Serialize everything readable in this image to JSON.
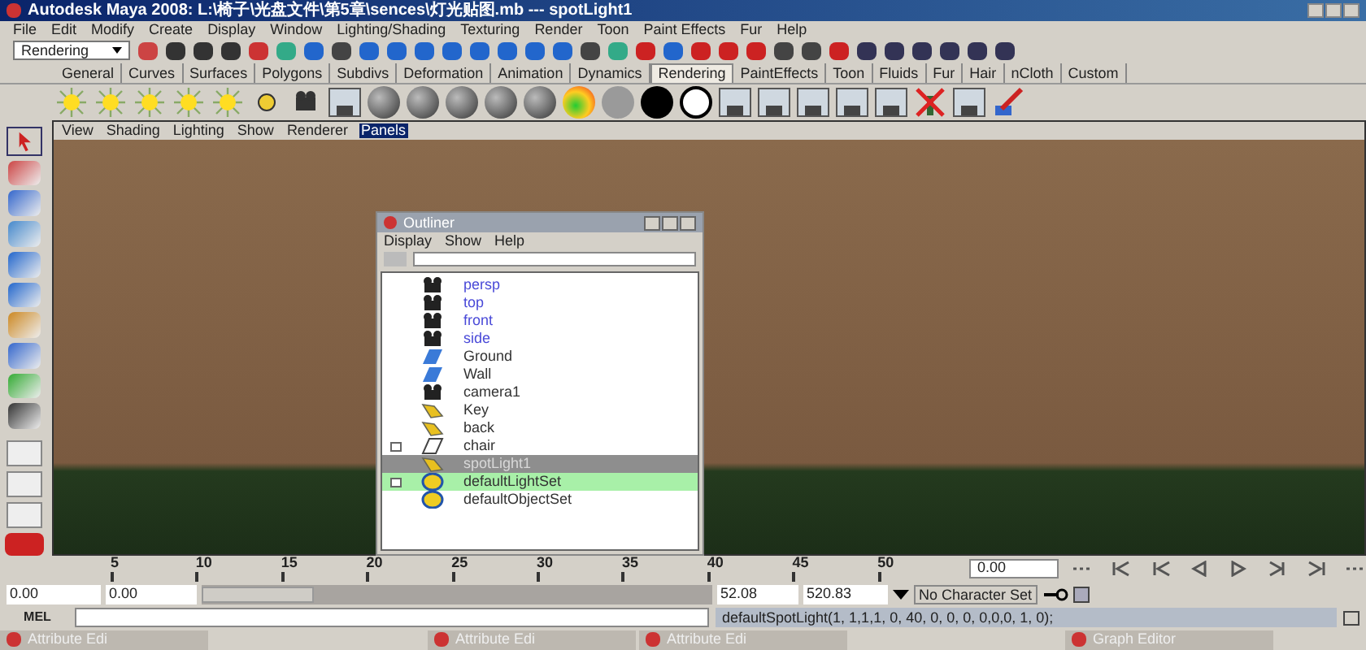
{
  "window": {
    "title": "Autodesk Maya 2008: L:\\椅子\\光盘文件\\第5章\\sences\\灯光贴图.mb  ---  spotLight1"
  },
  "menu": [
    "File",
    "Edit",
    "Modify",
    "Create",
    "Display",
    "Window",
    "Lighting/Shading",
    "Texturing",
    "Render",
    "Toon",
    "Paint Effects",
    "Fur",
    "Help"
  ],
  "status_line": {
    "menu_set": "Rendering"
  },
  "shelf_tabs": [
    {
      "label": "General",
      "selected": false
    },
    {
      "label": "Curves",
      "selected": false
    },
    {
      "label": "Surfaces",
      "selected": false
    },
    {
      "label": "Polygons",
      "selected": false
    },
    {
      "label": "Subdivs",
      "selected": false
    },
    {
      "label": "Deformation",
      "selected": false
    },
    {
      "label": "Animation",
      "selected": false
    },
    {
      "label": "Dynamics",
      "selected": false
    },
    {
      "label": "Rendering",
      "selected": true
    },
    {
      "label": "PaintEffects",
      "selected": false
    },
    {
      "label": "Toon",
      "selected": false
    },
    {
      "label": "Fluids",
      "selected": false
    },
    {
      "label": "Fur",
      "selected": false
    },
    {
      "label": "Hair",
      "selected": false
    },
    {
      "label": "nCloth",
      "selected": false
    },
    {
      "label": "Custom",
      "selected": false
    }
  ],
  "panel_menu": [
    {
      "label": "View",
      "selected": false
    },
    {
      "label": "Shading",
      "selected": false
    },
    {
      "label": "Lighting",
      "selected": false
    },
    {
      "label": "Show",
      "selected": false
    },
    {
      "label": "Renderer",
      "selected": false
    },
    {
      "label": "Panels",
      "selected": true
    }
  ],
  "outliner": {
    "title": "Outliner",
    "menu": [
      "Display",
      "Show",
      "Help"
    ],
    "items": [
      {
        "label": "persp",
        "kind": "camera",
        "color": "#4a4ad8",
        "expandable": false,
        "selected": false,
        "highlighted": false
      },
      {
        "label": "top",
        "kind": "camera",
        "color": "#4a4ad8",
        "expandable": false,
        "selected": false,
        "highlighted": false
      },
      {
        "label": "front",
        "kind": "camera",
        "color": "#4a4ad8",
        "expandable": false,
        "selected": false,
        "highlighted": false
      },
      {
        "label": "side",
        "kind": "camera",
        "color": "#4a4ad8",
        "expandable": false,
        "selected": false,
        "highlighted": false
      },
      {
        "label": "Ground",
        "kind": "mesh",
        "color": "#333333",
        "expandable": false,
        "selected": false,
        "highlighted": false
      },
      {
        "label": "Wall",
        "kind": "mesh",
        "color": "#333333",
        "expandable": false,
        "selected": false,
        "highlighted": false
      },
      {
        "label": "camera1",
        "kind": "camera",
        "color": "#333333",
        "expandable": false,
        "selected": false,
        "highlighted": false
      },
      {
        "label": "Key",
        "kind": "light",
        "color": "#333333",
        "expandable": false,
        "selected": false,
        "highlighted": false
      },
      {
        "label": "back",
        "kind": "light",
        "color": "#333333",
        "expandable": false,
        "selected": false,
        "highlighted": false
      },
      {
        "label": "chair",
        "kind": "group",
        "color": "#333333",
        "expandable": true,
        "selected": false,
        "highlighted": false
      },
      {
        "label": "spotLight1",
        "kind": "light",
        "color": "#d8d8d8",
        "expandable": false,
        "selected": true,
        "highlighted": false
      },
      {
        "label": "defaultLightSet",
        "kind": "set",
        "color": "#333333",
        "expandable": true,
        "selected": false,
        "highlighted": true
      },
      {
        "label": "defaultObjectSet",
        "kind": "set",
        "color": "#333333",
        "expandable": false,
        "selected": false,
        "highlighted": false
      }
    ]
  },
  "time_slider": {
    "ticks": [
      "5",
      "10",
      "15",
      "20",
      "25",
      "30",
      "35",
      "40",
      "45",
      "50"
    ],
    "current_frame": "0.00"
  },
  "range_slider": {
    "start": "0.00",
    "playback_start": "0.00",
    "level": 0.22,
    "playback_end": "52.08",
    "end": "520.83",
    "character_set": "No Character Set"
  },
  "command_line": {
    "label": "MEL",
    "result": "defaultSpotLight(1, 1,1,1, 0, 40, 0, 0, 0, 0,0,0, 1, 0);"
  },
  "taskbar": [
    {
      "label": "Attribute Edi"
    },
    {
      "label": "Attribute Edi"
    },
    {
      "label": "Attribute Edi"
    },
    {
      "label": "Graph Editor"
    }
  ]
}
